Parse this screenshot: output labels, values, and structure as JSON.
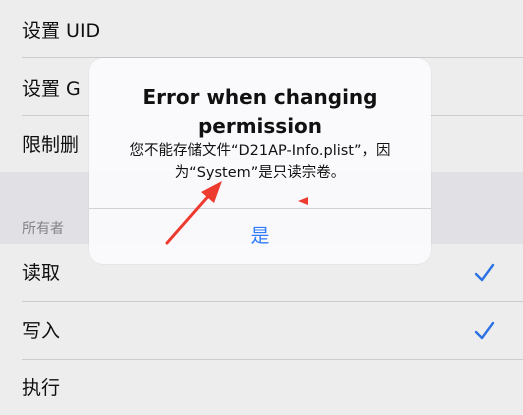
{
  "settings": {
    "rows": [
      {
        "label": "设置 UID"
      },
      {
        "label": "设置 G"
      },
      {
        "label": "限制删"
      }
    ],
    "owner_section": {
      "header": "所有者",
      "rows": [
        {
          "label": "读取",
          "checked": true
        },
        {
          "label": "写入",
          "checked": true
        },
        {
          "label": "执行",
          "checked": false
        }
      ]
    },
    "accent_color": "#2f7cf6"
  },
  "alert": {
    "title": "Error when changing permission",
    "message": "您不能存储文件“D21AP-Info.plist”，因为“System”是只读宗卷。",
    "button_label": "是"
  },
  "annotations": {
    "arrow_color": "#ee3b2f"
  }
}
